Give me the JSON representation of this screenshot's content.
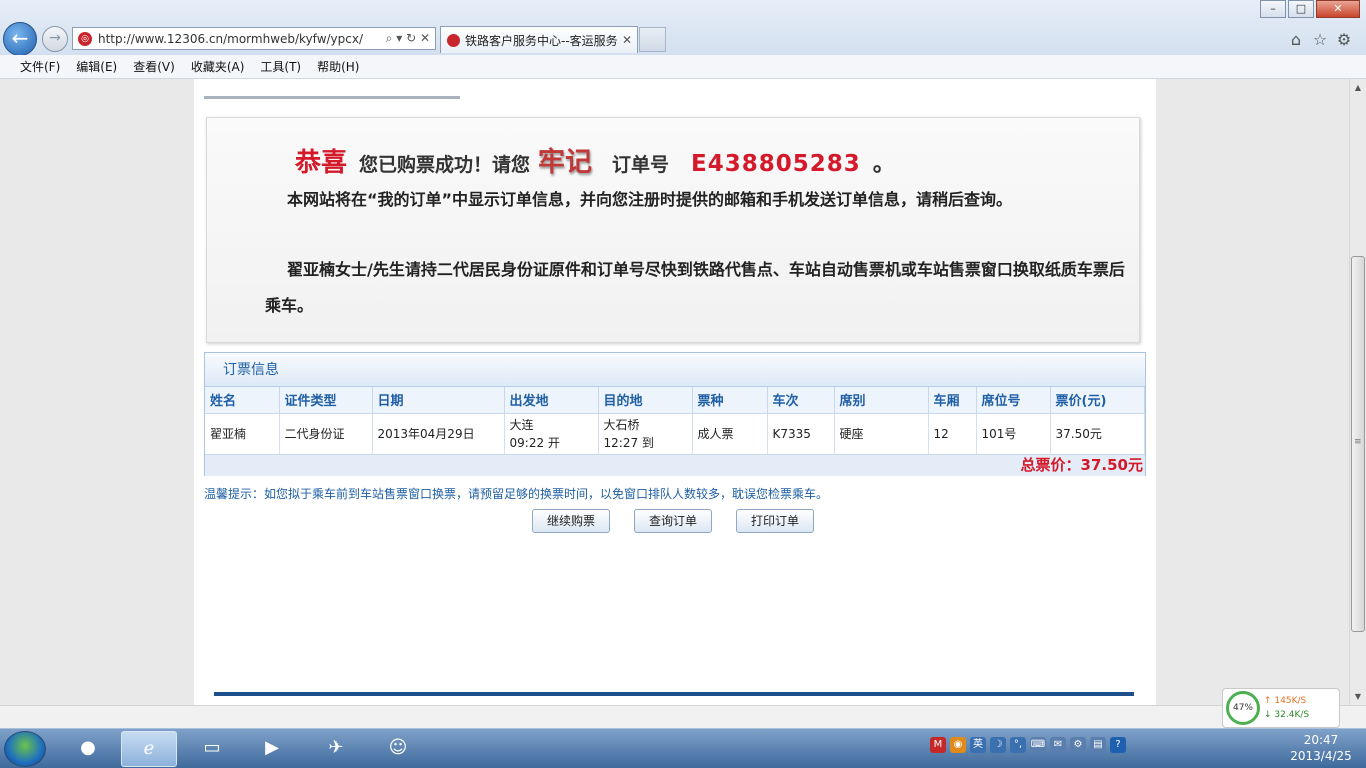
{
  "browser": {
    "window_buttons": {
      "minimize": "–",
      "maximize": "□",
      "close": "✕"
    },
    "back_icon": "←",
    "forward_icon": "→",
    "url": "http://www.12306.cn/mormhweb/kyfw/ypcx/",
    "url_controls": "⌕ ▾ ↻ ✕",
    "tab_title": "铁路客户服务中心--客运服务",
    "tab_close": "✕",
    "right_icons": [
      "⌂",
      "☆",
      "⚙"
    ]
  },
  "menu": [
    "文件(F)",
    "编辑(E)",
    "查看(V)",
    "收藏夹(A)",
    "工具(T)",
    "帮助(H)"
  ],
  "success": {
    "congrats": "恭喜",
    "text1": "您已购票成功！请您",
    "remember": "牢记",
    "text2": "订单号",
    "order_no": "E438805283",
    "period": "。",
    "para1": "本网站将在“我的订单”中显示订单信息，并向您注册时提供的邮箱和手机发送订单信息，请稍后查询。",
    "para2": "翟亚楠女士/先生请持二代居民身份证原件和订单号尽快到铁路代售点、车站自动售票机或车站售票窗口换取纸质车票后乘车。"
  },
  "order": {
    "title": "订票信息",
    "headers": [
      "姓名",
      "证件类型",
      "日期",
      "出发地",
      "目的地",
      "票种",
      "车次",
      "席别",
      "车厢",
      "席位号",
      "票价(元)"
    ],
    "row": {
      "name": "翟亚楠",
      "id_type": "二代身份证",
      "date": "2013年04月29日",
      "from": "大连",
      "depart": "09:22 开",
      "to": "大石桥",
      "arrive": "12:27 到",
      "ticket_type": "成人票",
      "train": "K7335",
      "seat_class": "硬座",
      "car": "12",
      "seat_no": "101号",
      "price": "37.50元"
    },
    "total": "总票价：37.50元"
  },
  "tip": "温馨提示：如您拟于乘车前到车站售票窗口换票，请预留足够的换票时间，以免窗口排队人数较多，耽误您检票乘车。",
  "buttons": [
    "继续购票",
    "查询订单",
    "打印订单"
  ],
  "speed": {
    "percent": "47%",
    "up": "↑ 145K/S",
    "down": "↓ 32.4K/S"
  },
  "clock": {
    "time": "20:47",
    "date": "2013/4/25"
  },
  "tray_icons": [
    "M",
    "◉",
    "英",
    "☽",
    "°,",
    "⌨",
    "✉",
    "⚙",
    "▤",
    "?"
  ],
  "taskbar_icons": [
    "start-orb",
    "360-icon",
    "ie-icon",
    "folder-icon",
    "media-icon",
    "bird-icon",
    "pps-icon"
  ]
}
